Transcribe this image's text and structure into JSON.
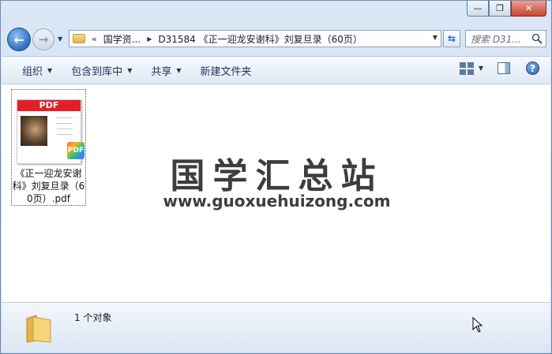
{
  "window": {
    "caption_min": "—",
    "caption_max": "❐",
    "caption_close": "✕"
  },
  "nav": {
    "back_glyph": "←",
    "forward_glyph": "→",
    "breadcrumb_chevron": "«",
    "breadcrumb": [
      "国学资...",
      "D31584 《正一迎龙安谢科》刘复旦录（60页）"
    ],
    "search_placeholder": "搜索 D31..."
  },
  "toolbar": {
    "organize": "组织",
    "include_in_library": "包含到库中",
    "share": "共享",
    "new_folder": "新建文件夹",
    "help": "?"
  },
  "files": [
    {
      "thumb_banner": "PDF",
      "badge": "PDF",
      "name": "《正一迎龙安谢科》刘复旦录（60页）.pdf"
    }
  ],
  "watermark": {
    "title": "国学汇总站",
    "url": "www.guoxuehuizong.com"
  },
  "status": {
    "item_count": "1 个对象"
  }
}
